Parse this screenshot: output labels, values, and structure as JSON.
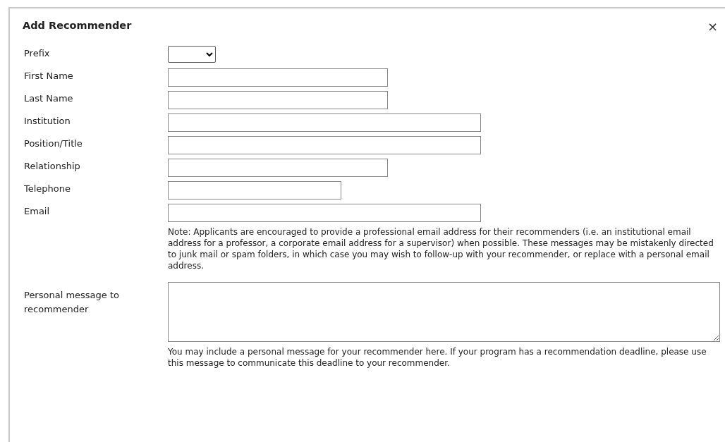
{
  "dialog": {
    "title": "Add Recommender",
    "close": "×"
  },
  "fields": [
    {
      "label": "Prefix",
      "kind": "select"
    },
    {
      "label": "First Name",
      "kind": "text"
    },
    {
      "label": "Last Name",
      "kind": "text"
    },
    {
      "label": "Institution",
      "kind": "text"
    },
    {
      "label": "Position/Title",
      "kind": "text"
    },
    {
      "label": "Relationship",
      "kind": "text"
    },
    {
      "label": "Telephone",
      "kind": "text"
    },
    {
      "label": "Email",
      "kind": "text",
      "note": "Note: Applicants are encouraged to provide a professional email address for their recommenders (i.e. an institutional email address for a professor, a corporate email address for a supervisor) when possible. These messages may be mistakenly directed to junk mail or spam folders, in which case you may wish to follow-up with your recommender, or replace with a personal email address."
    },
    {
      "label": "Personal message to recommender",
      "kind": "textarea",
      "note": "You may include a personal message for your recommender here. If your program has a recommendation deadline, please use this message to communicate this deadline to your recommender."
    }
  ]
}
